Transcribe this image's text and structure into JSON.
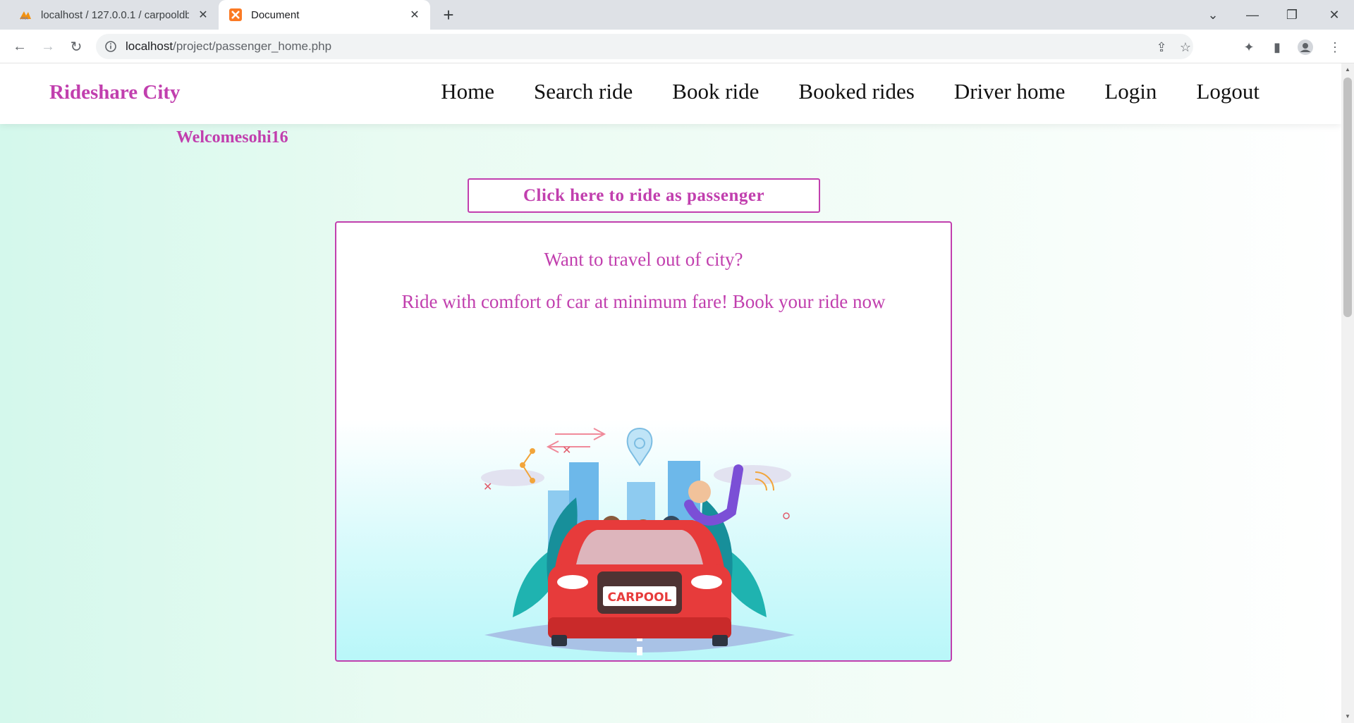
{
  "browser": {
    "tabs": [
      {
        "title": "localhost / 127.0.0.1 / carpooldb",
        "active": false,
        "favicon": "phpmyadmin-icon"
      },
      {
        "title": "Document",
        "active": true,
        "favicon": "xampp-icon"
      }
    ],
    "new_tab_label": "+",
    "url_host": "localhost",
    "url_path": "/project/passenger_home.php"
  },
  "site": {
    "brand": "Rideshare City",
    "nav": [
      "Home",
      "Search ride",
      "Book ride",
      "Booked rides",
      "Driver home",
      "Login",
      "Logout"
    ],
    "welcome": "Welcomesohi16",
    "ride_button": "Click here to ride as passenger",
    "card": {
      "line1": "Want to travel out of city?",
      "line2": "Ride with comfort of car at minimum fare! Book your ride now",
      "plate_text": "CARPOOL"
    },
    "accent_color": "#c13fae"
  }
}
